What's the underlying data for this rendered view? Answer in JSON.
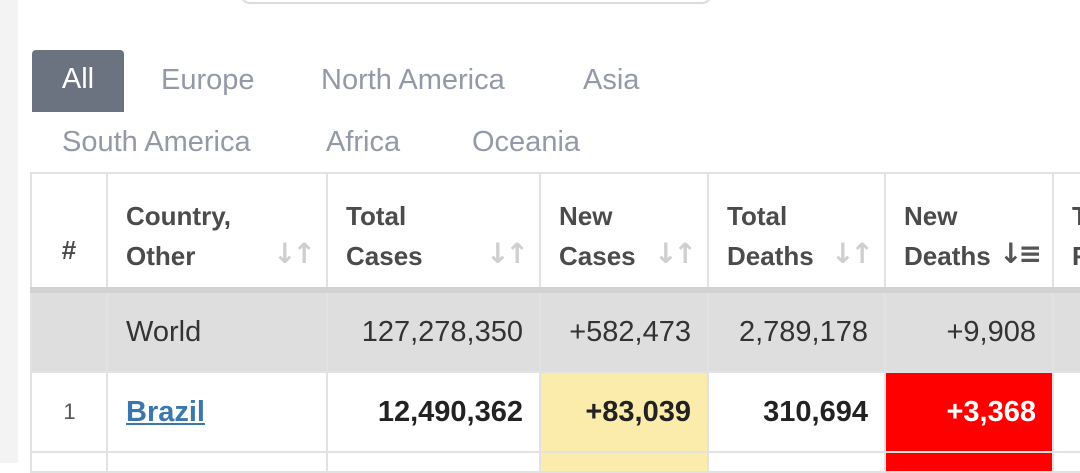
{
  "tabs": [
    {
      "label": "All",
      "active": true
    },
    {
      "label": "Europe"
    },
    {
      "label": "North America"
    },
    {
      "label": "Asia"
    },
    {
      "label": "South America"
    },
    {
      "label": "Africa"
    },
    {
      "label": "Oceania"
    }
  ],
  "table": {
    "headers": {
      "rank": "#",
      "country": [
        "Country,",
        "Other"
      ],
      "total_cases": [
        "Total",
        "Cases"
      ],
      "new_cases": [
        "New",
        "Cases"
      ],
      "total_deaths": [
        "Total",
        "Deaths"
      ],
      "new_deaths": [
        "New",
        "Deaths"
      ],
      "truncated": [
        "T",
        "F"
      ]
    },
    "sort_icons": {
      "inactive": "↓↑",
      "active": "↓≡"
    },
    "world": {
      "name": "World",
      "total_cases": "127,278,350",
      "new_cases": "+582,473",
      "total_deaths": "2,789,178",
      "new_deaths": "+9,908"
    },
    "rows": [
      {
        "rank": "1",
        "country": "Brazil",
        "total_cases": "12,490,362",
        "new_cases": "+83,039",
        "total_deaths": "310,694",
        "new_deaths": "+3,368"
      }
    ]
  },
  "colors": {
    "tab_active_bg": "#6b7280",
    "new_cases_highlight": "#fcecac",
    "new_deaths_highlight": "#ff0000",
    "link": "#3a77ad"
  }
}
